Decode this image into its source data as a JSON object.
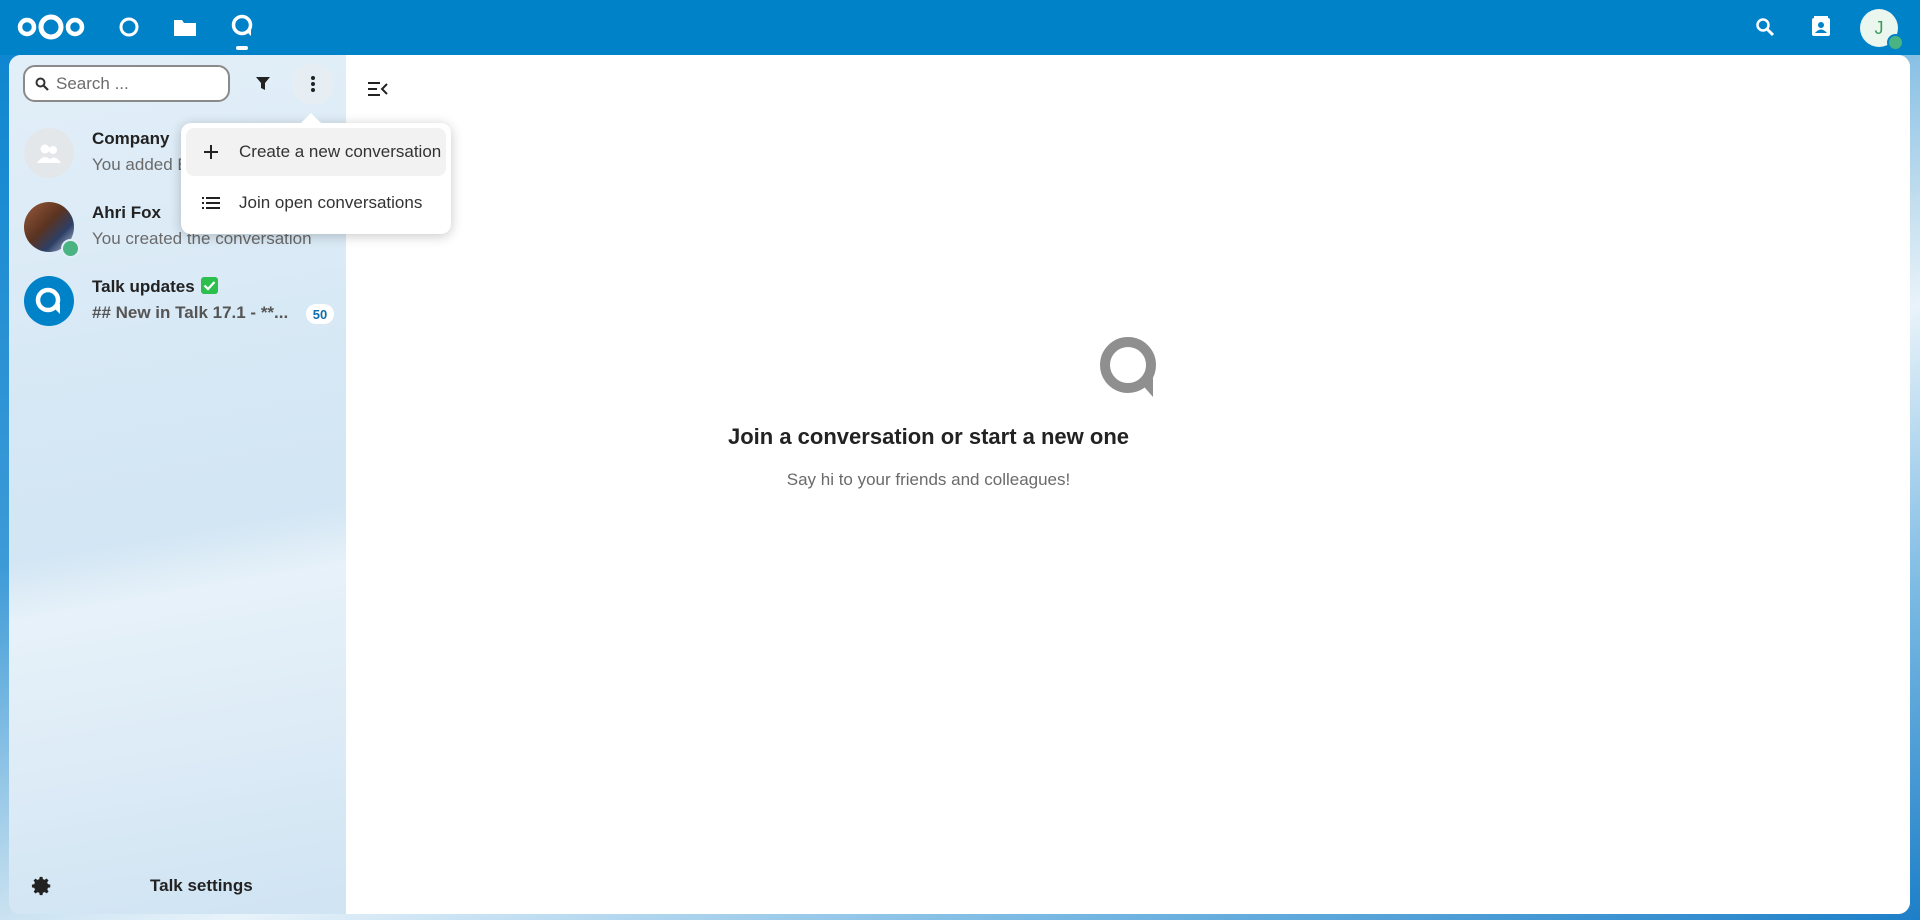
{
  "colors": {
    "header_bg": "#0082c9",
    "accent": "#0082c9",
    "online_status": "#49b382",
    "verified": "#2dbf4e"
  },
  "header": {
    "logo": "nextcloud-logo",
    "apps": [
      {
        "name": "dashboard",
        "icon": "circle-icon"
      },
      {
        "name": "files",
        "icon": "folder-icon"
      },
      {
        "name": "talk",
        "icon": "talk-icon",
        "active": true
      }
    ],
    "right_icons": [
      "search-icon",
      "contacts-icon"
    ],
    "user_avatar_initial": "J"
  },
  "sidebar": {
    "search_placeholder": "Search ...",
    "conversations": [
      {
        "name": "Company",
        "subtitle": "You added En",
        "avatar": "group-icon"
      },
      {
        "name": "Ahri Fox",
        "subtitle": "You created the conversation",
        "avatar": "user-photo",
        "online": true
      },
      {
        "name": "Talk updates",
        "subtitle": "## New in Talk 17.1 - **...",
        "avatar": "talk-icon",
        "verified": true,
        "unread": "50"
      }
    ],
    "settings_label": "Talk settings"
  },
  "menu": {
    "items": [
      {
        "label": "Create a new conversation",
        "icon": "plus-icon"
      },
      {
        "label": "Join open conversations",
        "icon": "list-icon"
      }
    ]
  },
  "empty": {
    "title": "Join a conversation or start a new one",
    "subtitle": "Say hi to your friends and colleagues!"
  }
}
